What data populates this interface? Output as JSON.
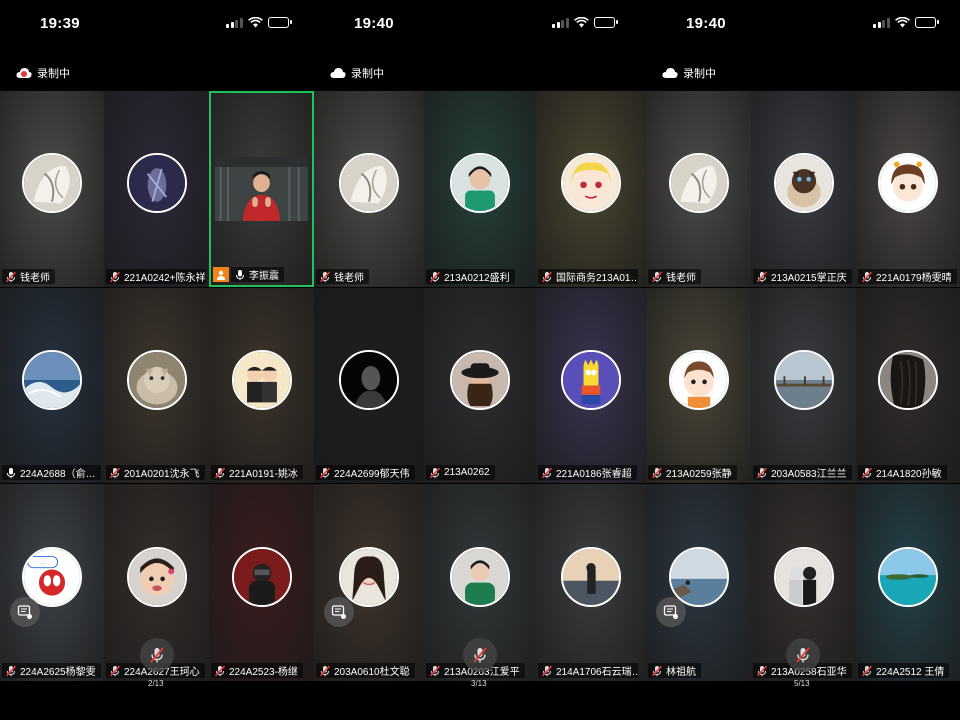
{
  "panels": [
    {
      "time": "19:39",
      "recording_label": "录制中",
      "recording_icon": "red-cloud",
      "page_indicator": "2/13",
      "tiles": [
        {
          "name": "钱老师",
          "mic": "muted",
          "bg": "#4d4c49",
          "avatar": "white-fabric"
        },
        {
          "name": "221A0242+陈永祥",
          "mic": "muted",
          "bg": "#2b2938",
          "avatar": "dark-purple"
        },
        {
          "name": "李振震",
          "mic": "on",
          "bg": "#3a3d3b",
          "avatar": "video",
          "host": true,
          "active": true
        },
        {
          "name": "224A2688（俞…",
          "mic": "on",
          "bg": "#26313f",
          "avatar": "blue-sea"
        },
        {
          "name": "201A0201沈永飞",
          "mic": "muted",
          "bg": "#3d352c",
          "avatar": "cat"
        },
        {
          "name": "221A0191-姚冰",
          "mic": "muted",
          "bg": "#3c332a",
          "avatar": "couple-cartoon"
        },
        {
          "name": "224A2625杨黎雯",
          "mic": "muted",
          "bg": "#3e4349",
          "avatar": "spiderman"
        },
        {
          "name": "224A2627王珂心",
          "mic": "muted",
          "bg": "#352e2b",
          "avatar": "child"
        },
        {
          "name": "224A2523-杨继",
          "mic": "muted",
          "bg": "#3b1c1e",
          "avatar": "dark-red"
        }
      ]
    },
    {
      "time": "19:40",
      "recording_label": "录制中",
      "recording_icon": "white-cloud",
      "page_indicator": "3/13",
      "tiles": [
        {
          "name": "钱老师",
          "mic": "muted",
          "bg": "#4d4c49",
          "avatar": "white-fabric"
        },
        {
          "name": "213A0212盛利",
          "mic": "muted",
          "bg": "#25403a",
          "avatar": "woman-green"
        },
        {
          "name": "国际商务213A01…",
          "mic": "muted",
          "bg": "#4a4630",
          "avatar": "anime-girl"
        },
        {
          "name": "224A2699郁天伟",
          "mic": "muted",
          "bg": "#1e1e1e",
          "avatar": "black-bw"
        },
        {
          "name": "213A0262",
          "mic": "muted",
          "bg": "#2d2d30",
          "avatar": "woman-hat"
        },
        {
          "name": "221A0186张睿超",
          "mic": "muted",
          "bg": "#3a3350",
          "avatar": "bart"
        },
        {
          "name": "203A0610杜文聪",
          "mic": "muted",
          "bg": "#3e332b",
          "avatar": "painted-woman"
        },
        {
          "name": "213A0203江爱平",
          "mic": "muted",
          "bg": "#33383a",
          "avatar": "woman-green2"
        },
        {
          "name": "214A1706石云瑞…",
          "mic": "muted",
          "bg": "#3b3d40",
          "avatar": "sunset-man"
        }
      ]
    },
    {
      "time": "19:40",
      "recording_label": "录制中",
      "recording_icon": "white-cloud",
      "page_indicator": "5/13",
      "tiles": [
        {
          "name": "钱老师",
          "mic": "muted",
          "bg": "#4d4c49",
          "avatar": "white-fabric"
        },
        {
          "name": "213A0215掌正庆",
          "mic": "muted",
          "bg": "#3a3d44",
          "avatar": "siamese-cat"
        },
        {
          "name": "221A0179杨雯晴",
          "mic": "muted",
          "bg": "#4b4745",
          "avatar": "anime-cute"
        },
        {
          "name": "213A0259张静",
          "mic": "muted",
          "bg": "#4a4638",
          "avatar": "cartoon-boy"
        },
        {
          "name": "203A0583江兰兰",
          "mic": "muted",
          "bg": "#3a3c40",
          "avatar": "pier"
        },
        {
          "name": "214A1820孙敏",
          "mic": "muted",
          "bg": "#302c2a",
          "avatar": "hair"
        },
        {
          "name": "林祖航",
          "mic": "muted",
          "bg": "#2c3742",
          "avatar": "coast"
        },
        {
          "name": "213A0258石亚华",
          "mic": "muted",
          "bg": "#35302e",
          "avatar": "couple-photo"
        },
        {
          "name": "224A2512 王倩",
          "mic": "muted",
          "bg": "#24414a",
          "avatar": "tropical"
        }
      ]
    }
  ],
  "colors": {
    "active_border": "#22c25a",
    "host_badge": "#f0861b",
    "muted_red": "#e53935",
    "recording_red": "#e53935"
  }
}
